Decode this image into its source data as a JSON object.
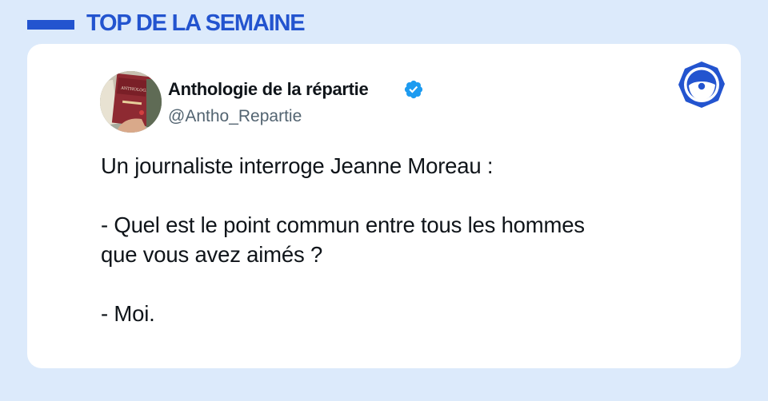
{
  "header": {
    "title": "TOP DE LA SEMAINE",
    "accent_color": "#2354cf",
    "background_color": "#dceafb"
  },
  "tweet": {
    "author": {
      "name": "Anthologie de la répartie",
      "handle": "@Antho_Repartie",
      "verified": true,
      "avatar_icon": "book-cover-avatar",
      "avatar_book_title": "ANTHOLOGIE DE LA RÉPARTIE"
    },
    "paragraphs": [
      [
        "Un journaliste interroge Jeanne Moreau :"
      ],
      [
        "- Quel est le point commun entre tous les hommes",
        "que vous avez aimés ?"
      ],
      [
        "- Moi."
      ]
    ]
  },
  "brand_logo": {
    "icon": "round-face-logo-icon",
    "color": "#2354cf"
  }
}
